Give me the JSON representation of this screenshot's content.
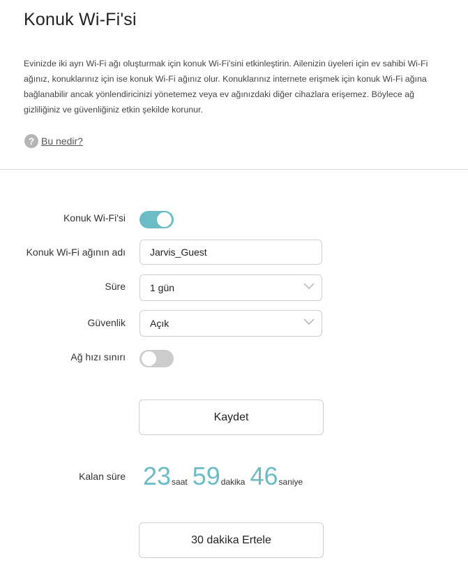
{
  "page": {
    "title": "Konuk Wi-Fi'si",
    "description": "Evinizde iki ayrı Wi-Fi ağı oluşturmak için konuk Wi-Fi'sini etkinleştirin. Ailenizin üyeleri için ev sahibi Wi-Fi ağınız, konuklarınız için ise konuk Wi-Fi ağınız olur. Konuklarınız internete erişmek için konuk Wi-Fi ağına bağlanabilir ancak yönlendiricinizi yönetemez veya ev ağınızdaki diğer cihazlara erişemez. Böylece ağ gizliliğiniz ve güvenliğiniz etkin şekilde korunur.",
    "help_link": "Bu nedir?",
    "help_icon": "question-circle-icon"
  },
  "form": {
    "guest_wifi": {
      "label": "Konuk Wi-Fi'si",
      "enabled": true
    },
    "network_name": {
      "label": "Konuk Wi-Fi ağının adı",
      "value": "Jarvis_Guest"
    },
    "duration": {
      "label": "Süre",
      "value": "1 gün"
    },
    "security": {
      "label": "Güvenlik",
      "value": "Açık"
    },
    "speed_limit": {
      "label": "Ağ hızı sınırı",
      "enabled": false
    },
    "save_label": "Kaydet"
  },
  "remaining": {
    "label": "Kalan süre",
    "hours": "23",
    "hours_unit": "saat",
    "minutes": "59",
    "minutes_unit": "dakika",
    "seconds": "46",
    "seconds_unit": "saniye"
  },
  "postpone_label": "30 dakika Ertele",
  "colors": {
    "accent": "#6bbcc5",
    "toggle_off": "#cccccc",
    "border": "#cfcfcf",
    "divider": "#d8d8d8"
  }
}
